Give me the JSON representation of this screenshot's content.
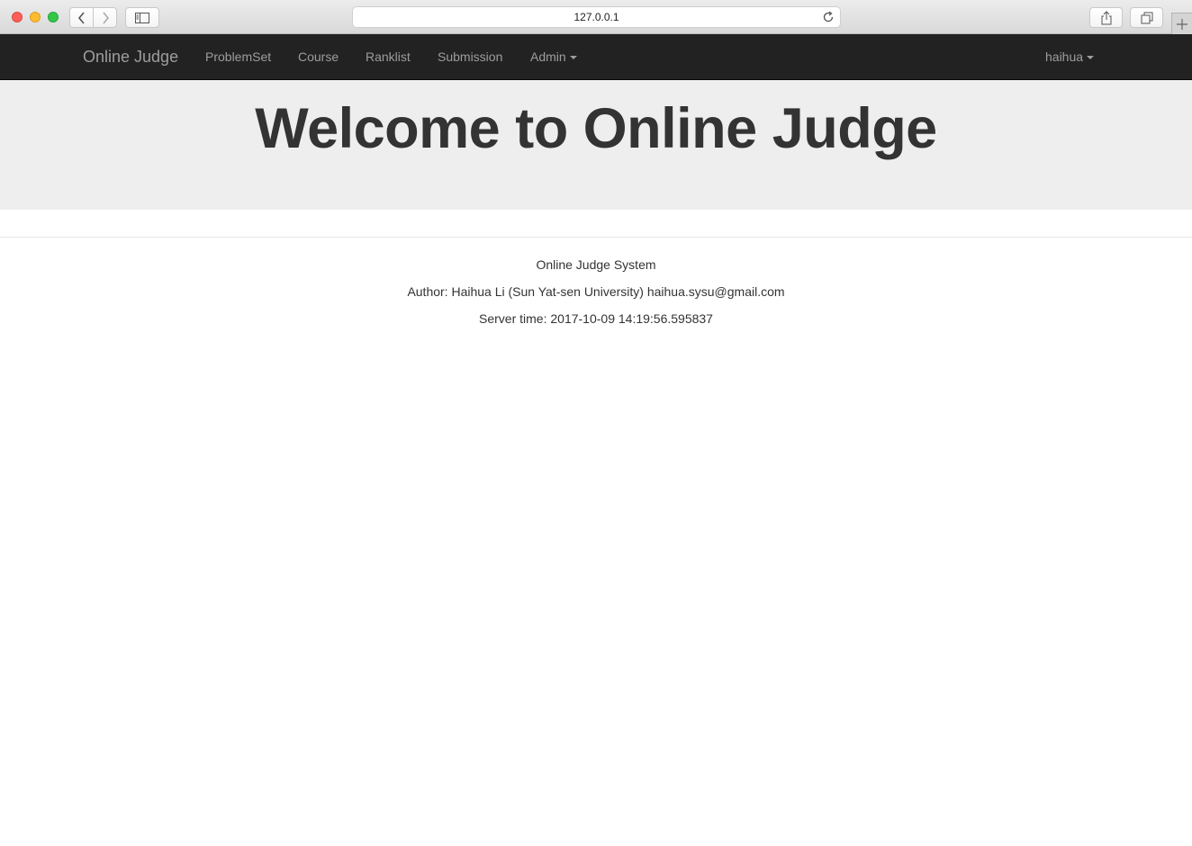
{
  "browser": {
    "url": "127.0.0.1",
    "icons": {
      "back": "chevron-left-icon",
      "forward": "chevron-right-icon",
      "sidebar": "sidebar-icon",
      "reload": "reload-icon",
      "share": "share-icon",
      "tabs": "tabs-overview-icon",
      "new_tab": "plus-icon"
    }
  },
  "navbar": {
    "brand": "Online Judge",
    "items": [
      {
        "label": "ProblemSet"
      },
      {
        "label": "Course"
      },
      {
        "label": "Ranklist"
      },
      {
        "label": "Submission"
      },
      {
        "label": "Admin",
        "dropdown": true
      }
    ],
    "user": {
      "label": "haihua",
      "dropdown": true
    }
  },
  "jumbotron": {
    "title": "Welcome to Online Judge"
  },
  "footer": {
    "system": "Online Judge System",
    "author": "Author: Haihua Li (Sun Yat-sen University) haihua.sysu@gmail.com",
    "server_time": "Server time: 2017-10-09 14:19:56.595837"
  },
  "colors": {
    "navbar_bg": "#222222",
    "navbar_text": "#9d9d9d",
    "jumbotron_bg": "#eeeeee",
    "text": "#333333"
  }
}
